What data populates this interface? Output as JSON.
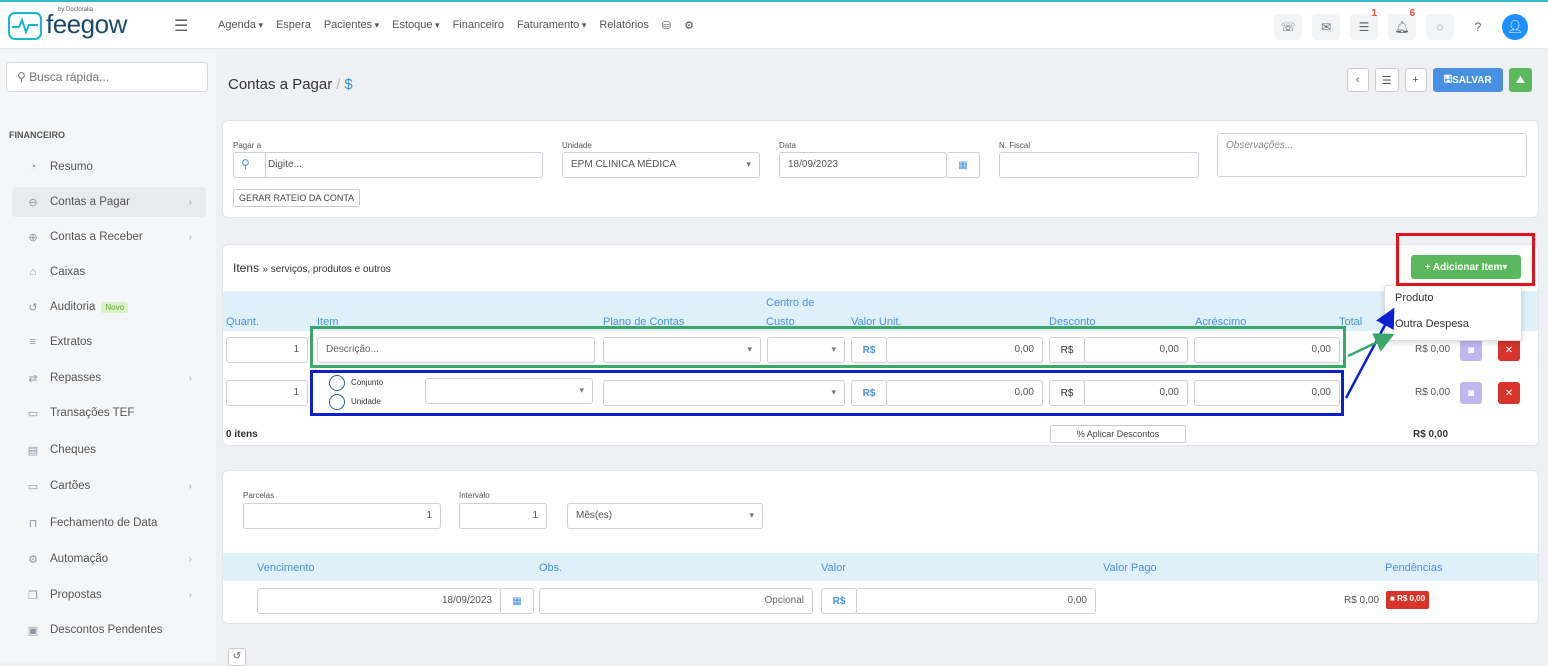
{
  "brand": {
    "by": "by Doctoralia",
    "name": "feegow"
  },
  "menu": [
    "Agenda",
    "Espera",
    "Pacientes",
    "Estoque",
    "Financeiro",
    "Faturamento",
    "Relatórios"
  ],
  "badges": {
    "tasks": "1",
    "notifications": "6"
  },
  "sidebar": {
    "search_placeholder": "Busca rápida...",
    "section": "FINANCEIRO",
    "items": [
      {
        "label": "Resumo"
      },
      {
        "label": "Contas a Pagar"
      },
      {
        "label": "Contas a Receber"
      },
      {
        "label": "Caixas"
      },
      {
        "label": "Auditoria",
        "tag": "Novo"
      },
      {
        "label": "Extratos"
      },
      {
        "label": "Repasses"
      },
      {
        "label": "Transações TEF"
      },
      {
        "label": "Cheques"
      },
      {
        "label": "Cartões"
      },
      {
        "label": "Fechamento de Data"
      },
      {
        "label": "Automação"
      },
      {
        "label": "Propostas"
      },
      {
        "label": "Descontos Pendentes"
      }
    ]
  },
  "page": {
    "title": "Contas a Pagar",
    "sep": "/",
    "symbol": "$",
    "save": "SALVAR"
  },
  "form": {
    "pagar_label": "Pagar a",
    "pagar_placeholder": "Digite...",
    "unidade_label": "Unidade",
    "unidade_value": "EPM CLINICA MÉDICA",
    "data_label": "Data",
    "data_value": "18/09/2023",
    "nfiscal_label": "N. Fiscal",
    "obs_placeholder": "Observações...",
    "rateio": "GERAR RATEIO DA CONTA"
  },
  "items": {
    "title": "Itens",
    "subtitle": "» serviços, produtos e outros",
    "add": "+ Adicionar Item",
    "menu": [
      "Produto",
      "Outra Despesa"
    ],
    "headers": {
      "quant": "Quant.",
      "item": "Item",
      "plano": "Plano de Contas",
      "centro": "Centro de Custo",
      "centro1": "Centro de",
      "centro2": "Custo",
      "valor": "Valor Unit.",
      "desconto": "Desconto",
      "acrescimo": "Acréscimo",
      "total": "Total"
    },
    "row1": {
      "qty": "1",
      "desc_placeholder": "Descrição...",
      "rs": "R$",
      "valor": "0,00",
      "desconto": "0,00",
      "acrescimo": "0,00",
      "total": "R$ 0,00"
    },
    "row2": {
      "qty": "1",
      "conjunto": "Conjunto",
      "unidade": "Unidade",
      "rs": "R$",
      "valor": "0,00",
      "desconto": "0,00",
      "acrescimo": "0,00",
      "total": "R$ 0,00"
    },
    "count": "0 itens",
    "aplicar": "% Aplicar Descontos",
    "sum": "R$ 0,00"
  },
  "parcelas": {
    "parcelas_label": "Parcelas",
    "parcelas_value": "1",
    "intervalo_label": "Intervalo",
    "intervalo_value": "1",
    "periodo": "Mês(es)",
    "headers": {
      "venc": "Vencimento",
      "obs": "Obs.",
      "valor": "Valor",
      "pago": "Valor Pago",
      "pend": "Pendências"
    },
    "row": {
      "venc": "18/09/2023",
      "obs": "Opcional",
      "rs": "R$",
      "valor": "0,00",
      "pago": "R$ 0,00",
      "pend": "R$ 0,00"
    }
  }
}
